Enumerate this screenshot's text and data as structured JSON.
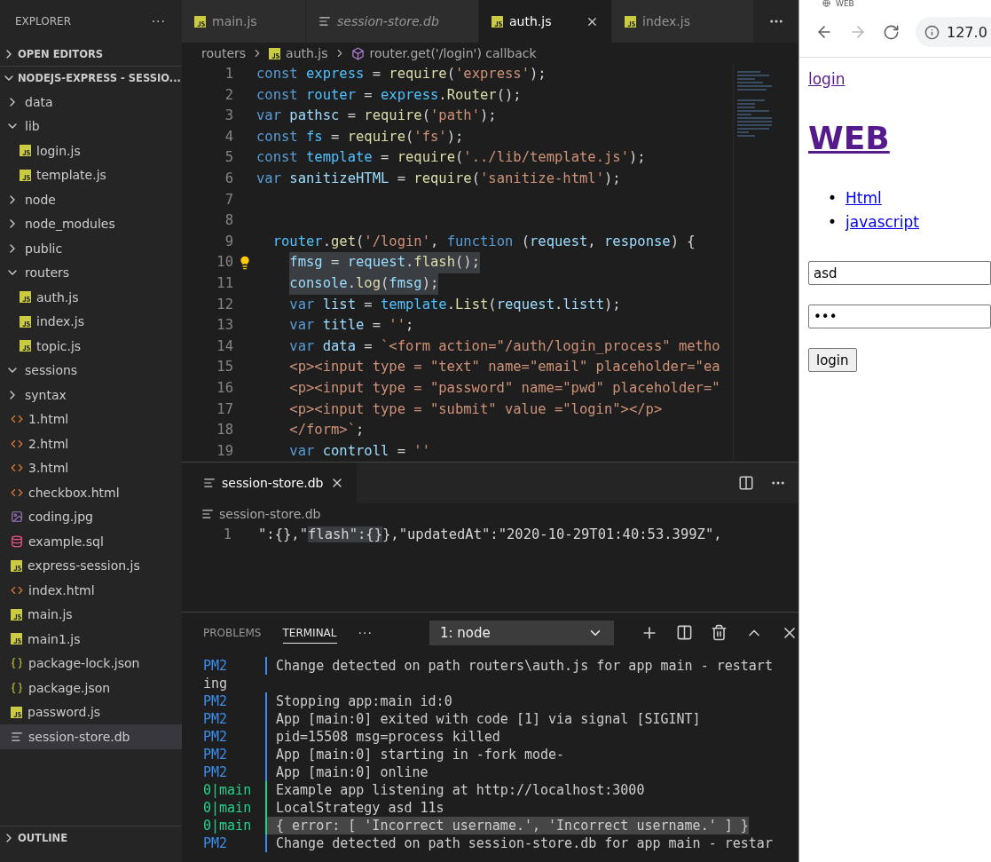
{
  "sidebar": {
    "title": "EXPLORER",
    "more": "···",
    "open_editors": {
      "title": "OPEN EDITORS",
      "expanded": false
    },
    "project": {
      "title": "NODEJS-EXPRESS - SESSIO...",
      "expanded": true,
      "items": [
        {
          "name": "data",
          "kind": "folder",
          "expanded": false,
          "selected": false
        },
        {
          "name": "lib",
          "kind": "folder",
          "expanded": true,
          "selected": false,
          "children": [
            {
              "name": "login.js",
              "kind": "js",
              "selected": false
            },
            {
              "name": "template.js",
              "kind": "js",
              "selected": false
            }
          ]
        },
        {
          "name": "node",
          "kind": "folder",
          "expanded": false,
          "selected": false
        },
        {
          "name": "node_modules",
          "kind": "folder",
          "expanded": false,
          "selected": false
        },
        {
          "name": "public",
          "kind": "folder",
          "expanded": false,
          "selected": false
        },
        {
          "name": "routers",
          "kind": "folder",
          "expanded": true,
          "selected": false,
          "children": [
            {
              "name": "auth.js",
              "kind": "js",
              "selected": false
            },
            {
              "name": "index.js",
              "kind": "js",
              "selected": false
            },
            {
              "name": "topic.js",
              "kind": "js",
              "selected": false
            }
          ]
        },
        {
          "name": "sessions",
          "kind": "folder",
          "expanded": true,
          "selected": false
        },
        {
          "name": "syntax",
          "kind": "folder",
          "expanded": false,
          "selected": false
        },
        {
          "name": "1.html",
          "kind": "html",
          "selected": false
        },
        {
          "name": "2.html",
          "kind": "html",
          "selected": false
        },
        {
          "name": "3.html",
          "kind": "html",
          "selected": false
        },
        {
          "name": "checkbox.html",
          "kind": "html",
          "selected": false
        },
        {
          "name": "coding.jpg",
          "kind": "image",
          "selected": false
        },
        {
          "name": "example.sql",
          "kind": "database",
          "selected": false
        },
        {
          "name": "express-session.js",
          "kind": "js",
          "selected": false
        },
        {
          "name": "index.html",
          "kind": "html",
          "selected": false
        },
        {
          "name": "main.js",
          "kind": "js",
          "selected": false
        },
        {
          "name": "main1.js",
          "kind": "js",
          "selected": false
        },
        {
          "name": "package-lock.json",
          "kind": "json",
          "selected": false
        },
        {
          "name": "package.json",
          "kind": "json",
          "selected": false
        },
        {
          "name": "password.js",
          "kind": "js",
          "selected": false
        },
        {
          "name": "session-store.db",
          "kind": "text",
          "selected": true
        }
      ]
    },
    "outline": {
      "title": "OUTLINE",
      "expanded": false
    }
  },
  "editor_tabs": [
    {
      "label": "main.js",
      "kind": "js",
      "selected": false,
      "preview": false
    },
    {
      "label": "session-store.db",
      "kind": "text",
      "selected": false,
      "preview": true
    },
    {
      "label": "auth.js",
      "kind": "js",
      "selected": true,
      "preview": false
    },
    {
      "label": "index.js",
      "kind": "js",
      "selected": false,
      "preview": false
    }
  ],
  "breadcrumbs": [
    {
      "label": "routers",
      "kind": "folder"
    },
    {
      "label": "auth.js",
      "kind": "js"
    },
    {
      "label": "router.get('/login') callback",
      "kind": "symbol"
    }
  ],
  "code": [
    {
      "number": "1",
      "kind": "top",
      "highlighted": false,
      "lightbulb": false,
      "tokens": [
        {
          "kind": "kw",
          "text": "const "
        },
        {
          "kind": "const",
          "text": "express"
        },
        {
          "kind": "punc",
          "text": " = "
        },
        {
          "kind": "fn",
          "text": "require"
        },
        {
          "kind": "punc",
          "text": "("
        },
        {
          "kind": "str",
          "text": "'express'"
        },
        {
          "kind": "punc",
          "text": ");"
        }
      ]
    },
    {
      "number": "2",
      "kind": "top",
      "highlighted": false,
      "lightbulb": false,
      "tokens": [
        {
          "kind": "kw",
          "text": "const "
        },
        {
          "kind": "const",
          "text": "router"
        },
        {
          "kind": "punc",
          "text": " = "
        },
        {
          "kind": "const",
          "text": "express"
        },
        {
          "kind": "punc",
          "text": "."
        },
        {
          "kind": "fn",
          "text": "Router"
        },
        {
          "kind": "punc",
          "text": "();"
        }
      ]
    },
    {
      "number": "3",
      "kind": "top",
      "highlighted": false,
      "lightbulb": false,
      "tokens": [
        {
          "kind": "kw",
          "text": "var "
        },
        {
          "kind": "var",
          "text": "pathsc"
        },
        {
          "kind": "punc",
          "text": " = "
        },
        {
          "kind": "fn",
          "text": "require"
        },
        {
          "kind": "punc",
          "text": "("
        },
        {
          "kind": "str",
          "text": "'path'"
        },
        {
          "kind": "punc",
          "text": ");"
        }
      ]
    },
    {
      "number": "4",
      "kind": "top",
      "highlighted": false,
      "lightbulb": false,
      "tokens": [
        {
          "kind": "kw",
          "text": "const "
        },
        {
          "kind": "const",
          "text": "fs"
        },
        {
          "kind": "punc",
          "text": " = "
        },
        {
          "kind": "fn",
          "text": "require"
        },
        {
          "kind": "punc",
          "text": "("
        },
        {
          "kind": "str",
          "text": "'fs'"
        },
        {
          "kind": "punc",
          "text": ");"
        }
      ]
    },
    {
      "number": "5",
      "kind": "top",
      "highlighted": false,
      "lightbulb": false,
      "tokens": [
        {
          "kind": "kw",
          "text": "const "
        },
        {
          "kind": "const",
          "text": "template"
        },
        {
          "kind": "punc",
          "text": " = "
        },
        {
          "kind": "fn",
          "text": "require"
        },
        {
          "kind": "punc",
          "text": "("
        },
        {
          "kind": "str",
          "text": "'../lib/template.js'"
        },
        {
          "kind": "punc",
          "text": ");"
        }
      ]
    },
    {
      "number": "6",
      "kind": "top",
      "highlighted": false,
      "lightbulb": false,
      "tokens": [
        {
          "kind": "kw",
          "text": "var "
        },
        {
          "kind": "var",
          "text": "sanitizeHTML"
        },
        {
          "kind": "punc",
          "text": " = "
        },
        {
          "kind": "fn",
          "text": "require"
        },
        {
          "kind": "punc",
          "text": "("
        },
        {
          "kind": "str",
          "text": "'sanitize-html'"
        },
        {
          "kind": "punc",
          "text": ");"
        }
      ]
    },
    {
      "number": "7",
      "kind": "blank",
      "highlighted": false,
      "lightbulb": false
    },
    {
      "number": "8",
      "kind": "blank",
      "highlighted": false,
      "lightbulb": false
    },
    {
      "number": "9",
      "kind": "call",
      "highlighted": false,
      "lightbulb": false,
      "tokens": [
        {
          "kind": "const",
          "text": "router"
        },
        {
          "kind": "punc",
          "text": "."
        },
        {
          "kind": "fn",
          "text": "get"
        },
        {
          "kind": "punc",
          "text": "("
        },
        {
          "kind": "str",
          "text": "'/login'"
        },
        {
          "kind": "punc",
          "text": ", "
        },
        {
          "kind": "kw",
          "text": "function"
        },
        {
          "kind": "punc",
          "text": " ("
        },
        {
          "kind": "var",
          "text": "request"
        },
        {
          "kind": "punc",
          "text": ", "
        },
        {
          "kind": "var",
          "text": "response"
        },
        {
          "kind": "punc",
          "text": ") {"
        }
      ]
    },
    {
      "number": "10",
      "kind": "body",
      "highlighted": true,
      "lightbulb": true,
      "tokens": [
        {
          "kind": "var",
          "text": "fmsg"
        },
        {
          "kind": "punc",
          "text": " = "
        },
        {
          "kind": "var",
          "text": "request"
        },
        {
          "kind": "punc",
          "text": "."
        },
        {
          "kind": "fn",
          "text": "flash"
        },
        {
          "kind": "punc",
          "text": "();"
        }
      ]
    },
    {
      "number": "11",
      "kind": "body",
      "highlighted": true,
      "lightbulb": false,
      "tokens": [
        {
          "kind": "var",
          "text": "console"
        },
        {
          "kind": "punc",
          "text": "."
        },
        {
          "kind": "fn",
          "text": "log"
        },
        {
          "kind": "punc",
          "text": "("
        },
        {
          "kind": "var",
          "text": "fmsg"
        },
        {
          "kind": "punc",
          "text": ");"
        }
      ]
    },
    {
      "number": "12",
      "kind": "body",
      "highlighted": false,
      "lightbulb": false,
      "tokens": [
        {
          "kind": "kw",
          "text": "var "
        },
        {
          "kind": "var",
          "text": "list"
        },
        {
          "kind": "punc",
          "text": " = "
        },
        {
          "kind": "const",
          "text": "template"
        },
        {
          "kind": "punc",
          "text": "."
        },
        {
          "kind": "fn",
          "text": "List"
        },
        {
          "kind": "punc",
          "text": "("
        },
        {
          "kind": "var",
          "text": "request"
        },
        {
          "kind": "punc",
          "text": "."
        },
        {
          "kind": "var",
          "text": "listt"
        },
        {
          "kind": "punc",
          "text": ");"
        }
      ]
    },
    {
      "number": "13",
      "kind": "body",
      "highlighted": false,
      "lightbulb": false,
      "tokens": [
        {
          "kind": "kw",
          "text": "var "
        },
        {
          "kind": "var",
          "text": "title"
        },
        {
          "kind": "punc",
          "text": " = "
        },
        {
          "kind": "str",
          "text": "''"
        },
        {
          "kind": "punc",
          "text": ";"
        }
      ]
    },
    {
      "number": "14",
      "kind": "body",
      "highlighted": false,
      "lightbulb": false,
      "tokens": [
        {
          "kind": "kw",
          "text": "var "
        },
        {
          "kind": "var",
          "text": "data"
        },
        {
          "kind": "punc",
          "text": " = "
        },
        {
          "kind": "str",
          "text": "`<form action=\"/auth/login_process\" metho"
        }
      ]
    },
    {
      "number": "15",
      "kind": "body",
      "highlighted": false,
      "lightbulb": false,
      "tokens": [
        {
          "kind": "str",
          "text": "<p><input type = \"text\" name=\"email\" placeholder=\"ea"
        }
      ]
    },
    {
      "number": "16",
      "kind": "body",
      "highlighted": false,
      "lightbulb": false,
      "tokens": [
        {
          "kind": "str",
          "text": "<p><input type = \"password\" name=\"pwd\" placeholder=\""
        }
      ]
    },
    {
      "number": "17",
      "kind": "body",
      "highlighted": false,
      "lightbulb": false,
      "tokens": [
        {
          "kind": "str",
          "text": "<p><input type = \"submit\" value =\"login\"></p>"
        }
      ]
    },
    {
      "number": "18",
      "kind": "body",
      "highlighted": false,
      "lightbulb": false,
      "tokens": [
        {
          "kind": "str",
          "text": "</form>`"
        },
        {
          "kind": "punc",
          "text": ";"
        }
      ]
    },
    {
      "number": "19",
      "kind": "body",
      "highlighted": false,
      "lightbulb": false,
      "tokens": [
        {
          "kind": "kw",
          "text": "var "
        },
        {
          "kind": "var",
          "text": "controll"
        },
        {
          "kind": "punc",
          "text": " = "
        },
        {
          "kind": "str",
          "text": "''"
        }
      ]
    }
  ],
  "second_editor": {
    "tab": {
      "label": "session-store.db",
      "selected": true
    },
    "breadcrumb": "session-store.db",
    "line": {
      "number": "1",
      "segments": [
        {
          "text": "\":{},\"",
          "highlighted": false
        },
        {
          "text": "flash\":{}",
          "highlighted": true
        },
        {
          "text": "},\"updatedAt\":\"2020-10-29T01:40:53.399Z\",",
          "highlighted": false
        }
      ]
    }
  },
  "panel": {
    "tabs": [
      {
        "label": "PROBLEMS",
        "selected": false
      },
      {
        "label": "TERMINAL",
        "selected": true
      }
    ],
    "more": "···",
    "terminal_select": "1: node",
    "lines": [
      {
        "source": "PM2",
        "kind": "pm2",
        "text": "Change detected on path routers\\auth.js for app main - restart",
        "highlighted": false
      },
      {
        "kind": "wrap",
        "text": "ing",
        "highlighted": false
      },
      {
        "source": "PM2",
        "kind": "pm2",
        "text": "Stopping app:main id:0",
        "highlighted": false
      },
      {
        "source": "PM2",
        "kind": "pm2",
        "text": "App [main:0] exited with code [1] via signal [SIGINT]",
        "highlighted": false
      },
      {
        "source": "PM2",
        "kind": "pm2",
        "text": "pid=15508 msg=process killed",
        "highlighted": false
      },
      {
        "source": "PM2",
        "kind": "pm2",
        "text": "App [main:0] starting in -fork mode-",
        "highlighted": false
      },
      {
        "source": "PM2",
        "kind": "pm2",
        "text": "App [main:0] online",
        "highlighted": false
      },
      {
        "source": "0|main",
        "kind": "app",
        "text": "Example app listening at http://localhost:3000",
        "highlighted": false
      },
      {
        "source": "0|main",
        "kind": "app",
        "text": "LocalStrategy asd 11s",
        "highlighted": false
      },
      {
        "source": "0|main",
        "kind": "app",
        "text": "{ error: [ 'Incorrect username.', 'Incorrect username.' ] }",
        "highlighted": true
      },
      {
        "source": "PM2",
        "kind": "pm2",
        "text": "Change detected on path session-store.db for app main - restar",
        "highlighted": false
      }
    ]
  },
  "browser": {
    "tab_title": "WEB",
    "address": "127.0",
    "page": {
      "top_link": "login",
      "heading": "WEB",
      "list": [
        {
          "bullet": "•",
          "label": "Html",
          "visited": false
        },
        {
          "bullet": "•",
          "label": "javascript",
          "visited": false
        }
      ],
      "fields": [
        {
          "value": "asd"
        },
        {
          "value": "•••"
        }
      ],
      "submit": "login"
    }
  }
}
